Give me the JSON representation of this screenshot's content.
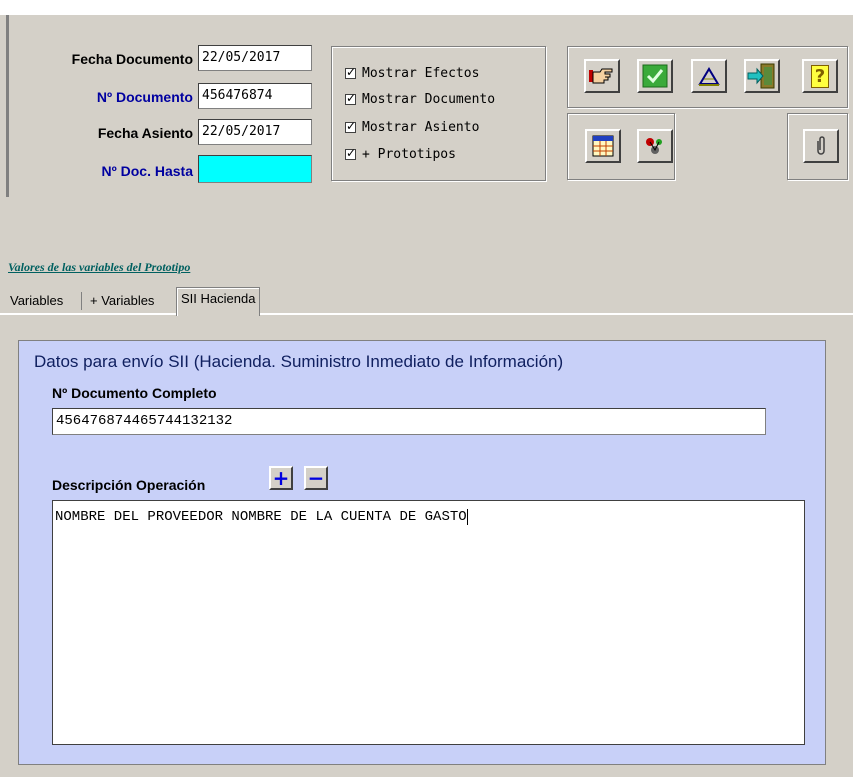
{
  "header": {
    "fecha_documento_label": "Fecha Documento",
    "fecha_documento_value": "22/05/2017",
    "n_documento_label": "Nº Documento",
    "n_documento_value": "456476874",
    "fecha_asiento_label": "Fecha Asiento",
    "fecha_asiento_value": "22/05/2017",
    "n_doc_hasta_label": "Nº Doc. Hasta",
    "n_doc_hasta_value": ""
  },
  "options": [
    {
      "label": "Mostrar Efectos",
      "checked": true
    },
    {
      "label": "Mostrar Documento",
      "checked": true
    },
    {
      "label": "Mostrar Asiento",
      "checked": true
    },
    {
      "label": "+ Prototipos",
      "checked": true
    }
  ],
  "toolbar": {
    "icons": [
      "pointing-hand-icon",
      "check-icon",
      "drafting-icon",
      "exit-door-icon",
      "help-icon",
      "table-icon",
      "molecule-icon",
      "paperclip-icon"
    ]
  },
  "link_text": "Valores de las variables del Prototipo",
  "tabs": [
    {
      "label": "Variables",
      "active": false
    },
    {
      "label": "+ Variables",
      "active": false
    },
    {
      "label": "SII Hacienda",
      "active": true
    }
  ],
  "panel": {
    "title": "Datos para envío SII (Hacienda. Suministro Inmediato de Información)",
    "doc_completo_label": "Nº Documento Completo",
    "doc_completo_value": "456476874465744132132",
    "descripcion_label": "Descripción Operación",
    "plus_label": "+",
    "minus_label": "−",
    "descripcion_value": "NOMBRE DEL PROVEEDOR NOMBRE DE LA CUENTA DE GASTO"
  },
  "colors": {
    "window_bg": "#d4d0c8",
    "panel_bg": "#c8d0f8",
    "highlight_field": "#00ffff",
    "label_blue": "#0000a0"
  }
}
